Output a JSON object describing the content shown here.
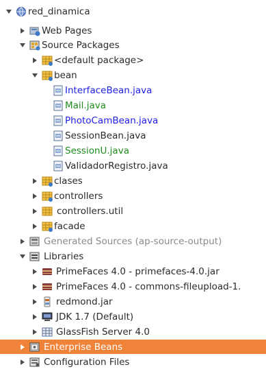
{
  "tree": {
    "project": "red_dinamica",
    "web_pages": "Web Pages",
    "source_packages": "Source Packages",
    "default_package": "<default package>",
    "bean": "bean",
    "bean_files": [
      "InterfaceBean.java",
      "Mail.java",
      "PhotoCamBean.java",
      "SessionBean.java",
      "SessionU.java",
      "ValidadorRegistro.java"
    ],
    "clases": "clases",
    "controllers": "controllers",
    "controllers_util": "controllers.util",
    "facade": "facade",
    "generated_sources": "Generated Sources (ap-source-output)",
    "libraries": "Libraries",
    "library_items": [
      "PrimeFaces 4.0 - primefaces-4.0.jar",
      "PrimeFaces 4.0 - commons-fileupload-1.",
      "redmond.jar",
      "JDK 1.7 (Default)",
      "GlassFish Server 4.0"
    ],
    "enterprise_beans": "Enterprise Beans",
    "configuration_files": "Configuration Files"
  },
  "colors": {
    "selection": "#f0833a",
    "modified_text": "#1e1ee6",
    "new_text": "#1f8c1f",
    "ignored_text": "#8a8a8a"
  }
}
